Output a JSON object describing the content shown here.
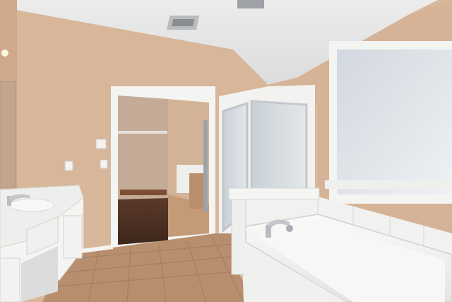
{
  "scene": {
    "description_free": true
  },
  "colors": {
    "wall": "#d9b89b",
    "wall_shadow": "#c9a485",
    "ceiling": "#e9e9ea",
    "trim": "#f3f3f2",
    "floor_tile": "#b88f6e",
    "floor_grout": "#a57d5f",
    "closet_floor": "#4a2f22",
    "closet_wall": "#cbb3a0",
    "window_glass": "#dfe4ea",
    "tub": "#f2f2f1",
    "cabinet": "#f4f4f3",
    "countertop": "#eeeeec",
    "shower_glass": "#cfd6dc",
    "vent": "#9ea2a6"
  },
  "icons": {
    "faucet": "faucet-icon",
    "light_switch": "light-switch-icon",
    "vent": "air-vent-icon",
    "ceiling_light": "ceiling-light-icon"
  }
}
